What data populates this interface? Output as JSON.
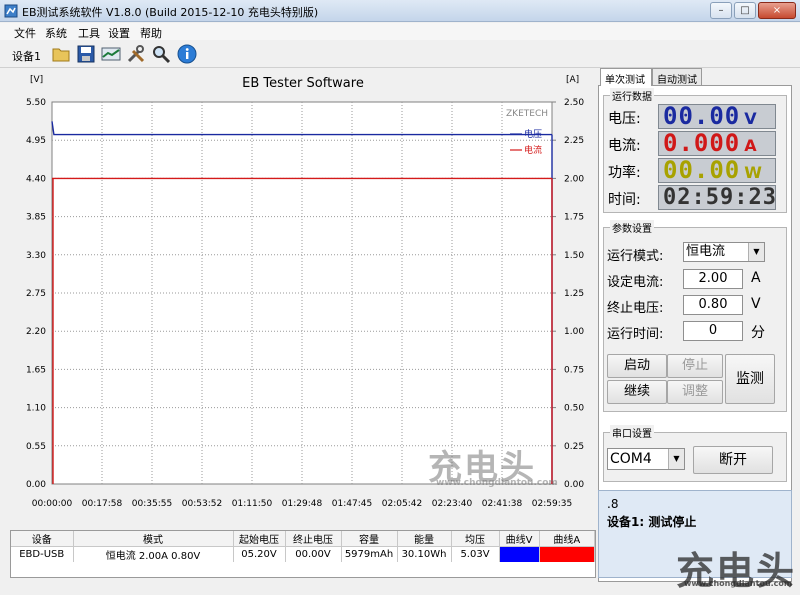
{
  "window": {
    "title": "EB测试系统软件 V1.8.0 (Build 2015-12-10 充电头特别版)",
    "minimize": "–",
    "maximize": "□",
    "close": "×"
  },
  "menu": [
    "文件",
    "系统",
    "工具",
    "设置",
    "帮助"
  ],
  "toolbar": {
    "device_label": "设备1",
    "icons": [
      "open-icon",
      "save-icon",
      "chart-icon",
      "tools-icon",
      "search-icon",
      "info-icon"
    ]
  },
  "chart_data": {
    "type": "line",
    "title": "EB Tester Software",
    "watermark": "ZKETECH",
    "left_unit": "[V]",
    "right_unit": "[A]",
    "left_axis": {
      "ylim": [
        0,
        5.5
      ],
      "ticks": [
        "0.00",
        "0.55",
        "1.10",
        "1.65",
        "2.20",
        "2.75",
        "3.30",
        "3.85",
        "4.40",
        "4.95",
        "5.50"
      ]
    },
    "right_axis": {
      "ylim": [
        0,
        2.5
      ],
      "ticks": [
        "0.00",
        "0.25",
        "0.50",
        "0.75",
        "1.00",
        "1.25",
        "1.50",
        "1.75",
        "2.00",
        "2.25",
        "2.50"
      ]
    },
    "x_ticks": [
      "00:00:00",
      "00:17:58",
      "00:35:55",
      "00:53:52",
      "01:11:50",
      "01:29:48",
      "01:47:45",
      "02:05:42",
      "02:23:40",
      "02:41:38",
      "02:59:35"
    ],
    "x_range_seconds": [
      0,
      10775
    ],
    "grid": true,
    "legend_position": "top-right",
    "series": [
      {
        "name": "电压",
        "axis": "left",
        "color": "#1a2aa0",
        "x": [
          0,
          40,
          100,
          10775
        ],
        "y": [
          5.22,
          5.03,
          5.03,
          5.03
        ]
      },
      {
        "name": "电流",
        "axis": "right",
        "color": "#d41a1a",
        "x": [
          0,
          10,
          10775
        ],
        "y": [
          2.0,
          2.0,
          2.0
        ]
      }
    ]
  },
  "stats_table": {
    "headers": [
      "设备",
      "模式",
      "起始电压",
      "终止电压",
      "容量",
      "能量",
      "均压",
      "曲线V",
      "曲线A"
    ],
    "row": [
      "EBD-USB",
      "恒电流  2.00A  0.80V",
      "05.20V",
      "00.00V",
      "5979mAh",
      "30.10Wh",
      "5.03V"
    ],
    "curve_v_color": "#0000ff",
    "curve_a_color": "#ff0000"
  },
  "tabs": [
    "单次测试",
    "自动测试"
  ],
  "run_data": {
    "group_title": "运行数据",
    "voltage_label": "电压:",
    "voltage_value": "00.00",
    "voltage_unit": "V",
    "voltage_color": "#1a2aa0",
    "current_label": "电流:",
    "current_value": "0.000",
    "current_unit": "A",
    "current_color": "#d01818",
    "power_label": "功率:",
    "power_value": "00.00",
    "power_unit": "W",
    "power_color": "#a8a200",
    "time_label": "时间:",
    "time_value": "02:59:23",
    "time_color": "#333333"
  },
  "params": {
    "group_title": "参数设置",
    "mode_label": "运行模式:",
    "mode_value": "恒电流",
    "current_label": "设定电流:",
    "current_value": "2.00",
    "current_unit": "A",
    "stop_v_label": "终止电压:",
    "stop_v_value": "0.80",
    "stop_v_unit": "V",
    "run_time_label": "运行时间:",
    "run_time_value": "0",
    "run_time_unit": "分",
    "start": "启动",
    "stop": "停止",
    "continue": "继续",
    "adjust": "调整",
    "monitor": "监测"
  },
  "serial": {
    "group_title": "串口设置",
    "port": "COM4",
    "disconnect": "断开"
  },
  "status": {
    "line1": ".8",
    "line2": "设备1: 测试停止"
  },
  "watermarks": [
    "充电头",
    "www.chongdiantou.com"
  ]
}
